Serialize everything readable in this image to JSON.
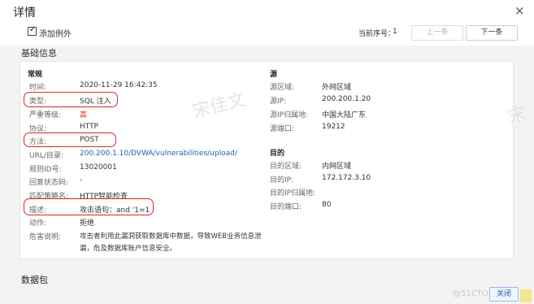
{
  "dialog": {
    "title": "详情",
    "close_icon": "×",
    "watermark": "宋佳文",
    "watermark2": "宋"
  },
  "toolbar": {
    "add_exception_label": "添加例外",
    "add_exception_checked": true,
    "seq_label": "当前序号：",
    "seq_value": "1",
    "prev_label": "上一条",
    "next_label": "下一条"
  },
  "basic": {
    "section_title": "基础信息",
    "general": {
      "title": "常规",
      "rows": [
        {
          "label": "时间:",
          "value": "2020-11-29 16:42:35"
        },
        {
          "label": "类型:",
          "value": "SQL 注入"
        },
        {
          "label": "严重等级:",
          "value": "高"
        },
        {
          "label": "协议:",
          "value": "HTTP"
        },
        {
          "label": "方法:",
          "value": "POST"
        },
        {
          "label": "URL/目录:",
          "value": "200.200.1.10/DVWA/vulnerabilities/upload/"
        },
        {
          "label": "规则ID号:",
          "value": "13020001"
        },
        {
          "label": "回复状态码:",
          "value": "-"
        },
        {
          "label": "匹配策略名:",
          "value": "HTTP智能检查"
        },
        {
          "label": "描述:",
          "value": "攻击语句：and '1=1"
        },
        {
          "label": "动作:",
          "value": "拒绝"
        },
        {
          "label": "危害说明:",
          "value": "攻击者利用此漏洞获取数据库中数据，导致WEB业务信息泄",
          "value2": "漏，危及数据库账户信息安全。"
        }
      ]
    },
    "source": {
      "title": "源",
      "rows": [
        {
          "label": "源区域:",
          "value": "外网区域"
        },
        {
          "label": "源IP:",
          "value": "200.200.1.20"
        },
        {
          "label": "源IP归属地:",
          "value": "中国大陆广东"
        },
        {
          "label": "源端口:",
          "value": "19212"
        }
      ]
    },
    "destination": {
      "title": "目的",
      "rows": [
        {
          "label": "目的区域:",
          "value": "内网区域"
        },
        {
          "label": "目的IP:",
          "value": "172.172.3.10"
        },
        {
          "label": "目的IP归属地:",
          "value": ""
        },
        {
          "label": "目的端口:",
          "value": "80"
        }
      ]
    }
  },
  "packet": {
    "section_title": "数据包"
  },
  "footer": {
    "confirm_label": "关闭",
    "watermark": "@51CTO博客"
  }
}
